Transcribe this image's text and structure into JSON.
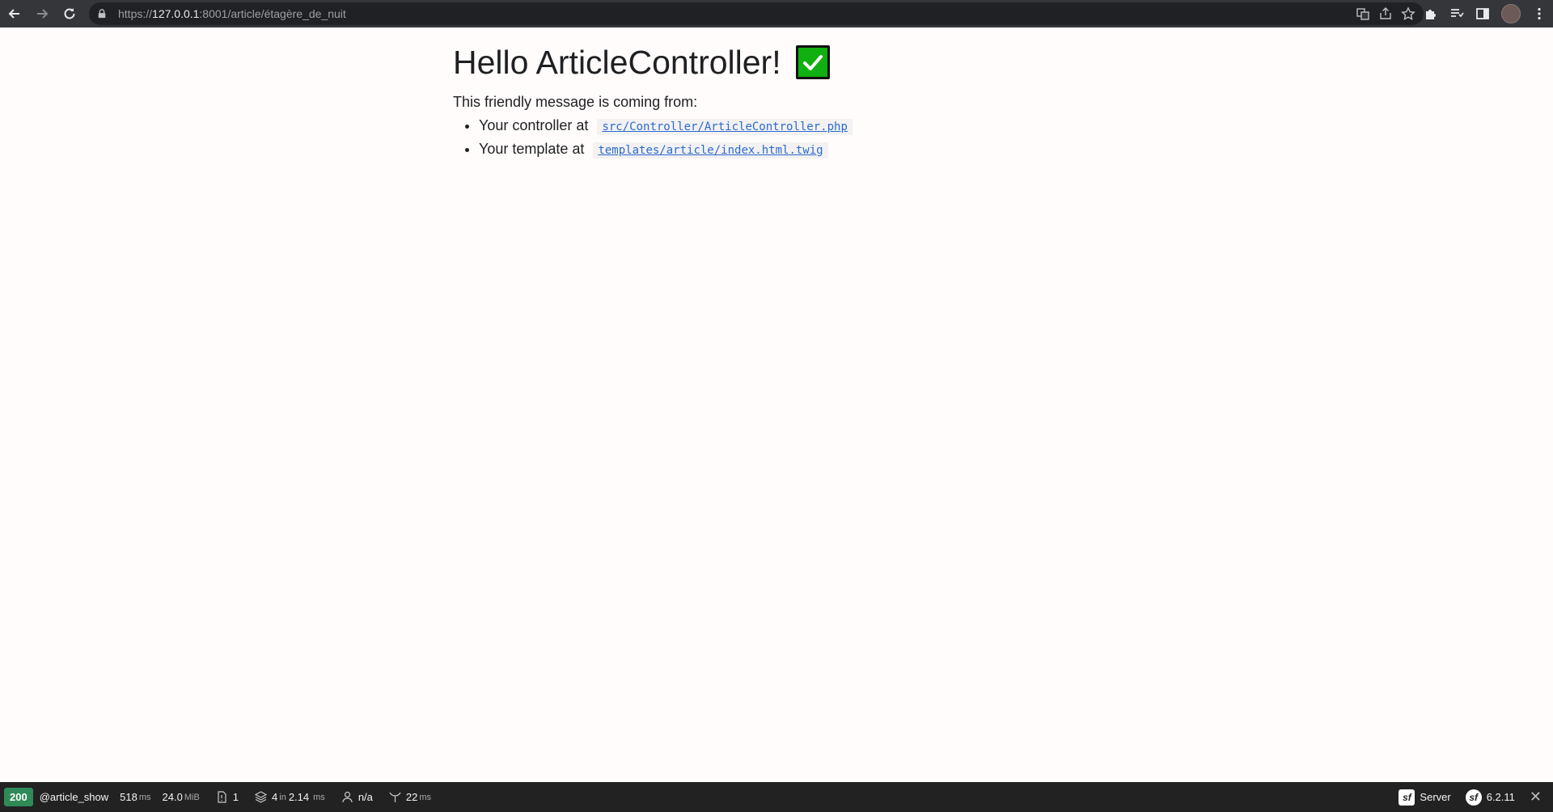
{
  "browser": {
    "url_scheme": "https://",
    "url_host": "127.0.0.1",
    "url_rest": ":8001/article/étagère_de_nuit"
  },
  "page": {
    "title": "Hello ArticleController!",
    "intro": "This friendly message is coming from:",
    "items": [
      {
        "label": "Your controller at",
        "link": "src/Controller/ArticleController.php"
      },
      {
        "label": "Your template at",
        "link": "templates/article/index.html.twig"
      }
    ]
  },
  "toolbar": {
    "status": "200",
    "route": "@article_show",
    "time_value": "518",
    "time_unit": "ms",
    "memory_value": "24.0",
    "memory_unit": "MiB",
    "logs_count": "1",
    "twig_count": "4",
    "twig_in": "in",
    "twig_time": "2.14",
    "twig_unit": "ms",
    "user": "n/a",
    "events_value": "22",
    "events_unit": "ms",
    "server_label": "Server",
    "version": "6.2.11",
    "status_color": "#2e8b57"
  },
  "icons": {
    "back": "arrow-left-icon",
    "forward": "arrow-right-icon",
    "reload": "reload-icon",
    "lock": "lock-icon",
    "translate": "translate-icon",
    "share": "share-icon",
    "bookmark": "star-icon",
    "extensions": "puzzle-icon",
    "reading_list": "reading-list-icon",
    "side_panel": "side-panel-icon",
    "menu": "kebab-menu-icon",
    "check": "check-mark-icon"
  }
}
